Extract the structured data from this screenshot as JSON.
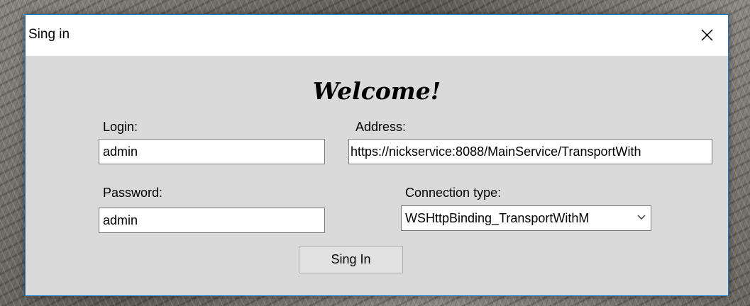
{
  "window": {
    "title": "Sing in",
    "close_icon": "close-icon",
    "border_color": "#1979ca",
    "background_color": "#dadada"
  },
  "form": {
    "heading": "Welcome!",
    "login": {
      "label": "Login:",
      "value": "admin"
    },
    "address": {
      "label": "Address:",
      "value": "https://nickservice:8088/MainService/TransportWith"
    },
    "password": {
      "label": "Password:",
      "value": "admin"
    },
    "connection_type": {
      "label": "Connection type:",
      "selected": "WSHttpBinding_TransportWithM",
      "arrow_icon": "chevron-down-icon"
    },
    "submit_label": "Sing In"
  }
}
